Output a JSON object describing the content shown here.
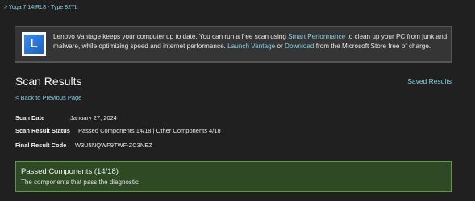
{
  "device": {
    "breadcrumb": "> Yoga 7 14IRL8 - Type 82YL"
  },
  "banner": {
    "logo_letter": "L",
    "text_1": "Lenovo Vantage keeps your computer up to date. You can run a free scan using ",
    "link_smart_performance": "Smart Performance",
    "text_2": " to clean up your PC from junk and malware, while optimizing speed and internet performance. ",
    "link_launch_vantage": "Launch Vantage",
    "text_3": " or ",
    "link_download": "Download",
    "text_4": " from the Microsoft Store free of charge."
  },
  "header": {
    "title": "Scan Results",
    "saved_results": "Saved Results",
    "back_link": "< Back to Previous Page"
  },
  "scan_info": {
    "scan_date_label": "Scan Date",
    "scan_date_value": "January 27, 2024",
    "status_label": "Scan Result Status",
    "status_value": "Passed Components 14/18 | Other Components 4/18",
    "code_label": "Final Result Code",
    "code_value": "W3U5NQWF9TWF-ZC3NEZ"
  },
  "passed_panel": {
    "title": "Passed Components (14/18)",
    "subtitle": "The components that pass the diagnostic"
  }
}
